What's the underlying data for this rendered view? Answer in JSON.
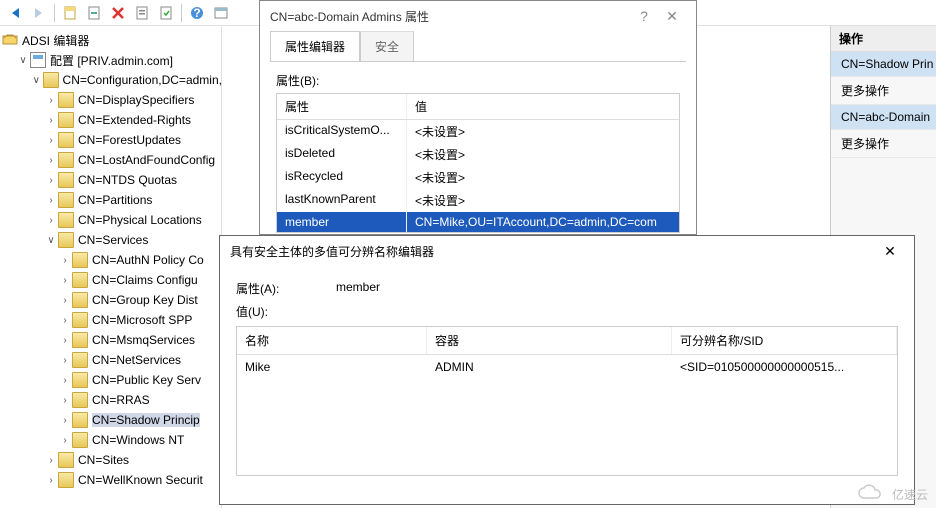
{
  "toolbar": {},
  "tree": {
    "root": "ADSI 编辑器",
    "config": "配置 [PRIV.admin.com]",
    "cn_top": "CN=Configuration,DC=admin,DC",
    "items_level3": [
      "CN=DisplaySpecifiers",
      "CN=Extended-Rights",
      "CN=ForestUpdates",
      "CN=LostAndFoundConfig",
      "CN=NTDS Quotas",
      "CN=Partitions",
      "CN=Physical Locations"
    ],
    "services": "CN=Services",
    "items_level4": [
      "CN=AuthN Policy Co",
      "CN=Claims Configu",
      "CN=Group Key Dist",
      "CN=Microsoft SPP",
      "CN=MsmqServices",
      "CN=NetServices",
      "CN=Public Key Serv",
      "CN=RRAS",
      "CN=Shadow Princip",
      "CN=Windows NT"
    ],
    "sites": "CN=Sites",
    "wellknown": "CN=WellKnown Securit"
  },
  "right": {
    "header": "操作",
    "item1": "CN=Shadow Prin",
    "item2": "更多操作",
    "item3": "CN=abc-Domain",
    "item4": "更多操作"
  },
  "dlg1": {
    "title": "CN=abc-Domain Admins 属性",
    "tab1": "属性编辑器",
    "tab2": "安全",
    "attr_label": "属性(B):",
    "col_name": "属性",
    "col_value": "值",
    "rows": [
      {
        "n": "isCriticalSystemO...",
        "v": "<未设置>"
      },
      {
        "n": "isDeleted",
        "v": "<未设置>"
      },
      {
        "n": "isRecycled",
        "v": "<未设置>"
      },
      {
        "n": "lastKnownParent",
        "v": "<未设置>"
      },
      {
        "n": "member",
        "v": "CN=Mike,OU=ITAccount,DC=admin,DC=com"
      }
    ]
  },
  "dlg2": {
    "title": "具有安全主体的多值可分辨名称编辑器",
    "attr_label": "属性(A):",
    "attr_value": "member",
    "value_label": "值(U):",
    "col1": "名称",
    "col2": "容器",
    "col3": "可分辨名称/SID",
    "row": {
      "name": "Mike",
      "container": "ADMIN",
      "dn": "<SID=010500000000000515..."
    }
  },
  "watermark": "亿速云"
}
